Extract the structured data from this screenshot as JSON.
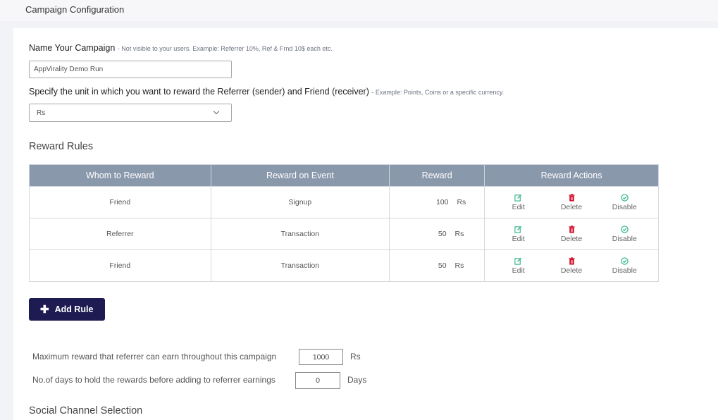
{
  "header": {
    "title": "Campaign Configuration"
  },
  "campaign_name": {
    "label": "Name Your Campaign",
    "hint": "- Not visible to your users. Example: Referrer 10%, Ref & Frnd 10$ each etc.",
    "value": "AppVirality Demo Run"
  },
  "reward_unit": {
    "label": "Specify the unit in which you want to reward the Referrer (sender) and Friend (receiver)",
    "hint": "- Example: Points, Coins or a specific currency.",
    "selected": "Rs"
  },
  "reward_rules": {
    "title": "Reward Rules",
    "columns": [
      "Whom to Reward",
      "Reward on Event",
      "Reward",
      "Reward Actions"
    ],
    "actions": {
      "edit": "Edit",
      "delete": "Delete",
      "disable": "Disable"
    },
    "rows": [
      {
        "whom": "Friend",
        "event": "Signup",
        "amount": "100",
        "unit": "Rs"
      },
      {
        "whom": "Referrer",
        "event": "Transaction",
        "amount": "50",
        "unit": "Rs"
      },
      {
        "whom": "Friend",
        "event": "Transaction",
        "amount": "50",
        "unit": "Rs"
      }
    ],
    "colors": {
      "header_bg": "#8a98ac",
      "edit": "#2ab38a",
      "delete": "#d0021b",
      "disable": "#2ab38a"
    }
  },
  "add_rule": {
    "label": "Add Rule",
    "color": "#1d1b52"
  },
  "limits": {
    "max_reward_label": "Maximum reward that referrer can earn throughout this campaign",
    "max_reward_value": "1000",
    "max_reward_unit": "Rs",
    "hold_days_label": "No.of days to hold the rewards before adding to referrer earnings",
    "hold_days_value": "0",
    "hold_days_unit": "Days"
  },
  "social": {
    "title": "Social Channel Selection"
  }
}
